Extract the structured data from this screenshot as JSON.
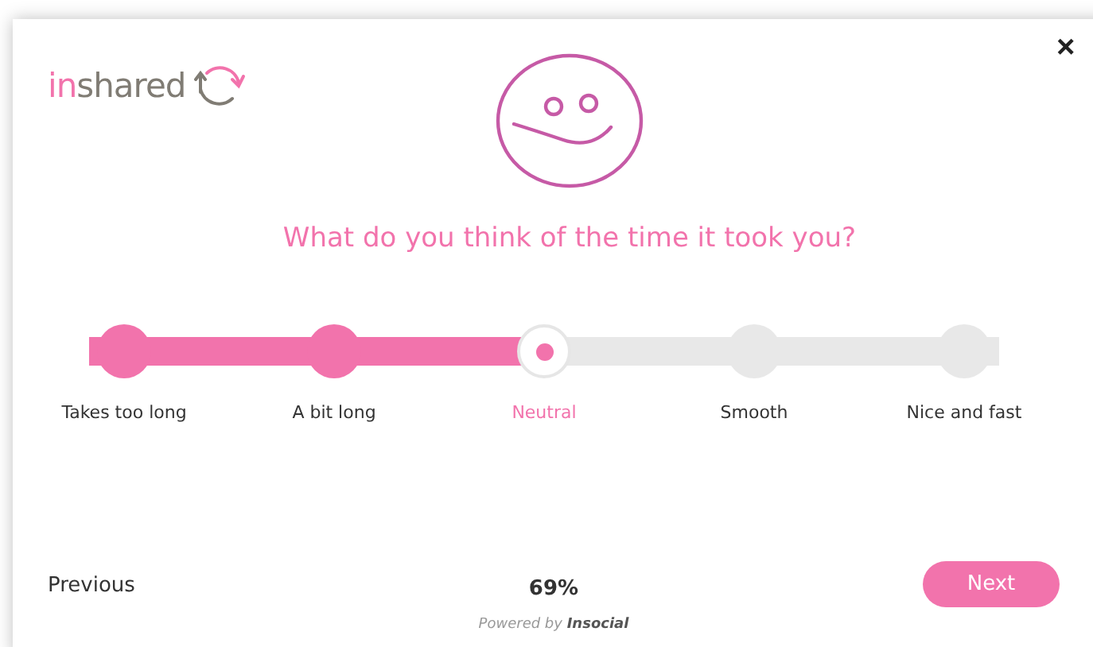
{
  "logo": {
    "accent": "in",
    "rest": "shared"
  },
  "close": "×",
  "question": "What do you think of the time it took you?",
  "scale": {
    "level": 0.5,
    "options": [
      {
        "label": "Takes too long",
        "selected": false
      },
      {
        "label": "A bit long",
        "selected": false
      },
      {
        "label": "Neutral",
        "selected": true
      },
      {
        "label": "Smooth",
        "selected": false
      },
      {
        "label": "Nice and fast",
        "selected": false
      }
    ]
  },
  "footer": {
    "previous": "Previous",
    "progress": "69%",
    "next": "Next",
    "powered_by": "Powered by **Insocial**"
  }
}
